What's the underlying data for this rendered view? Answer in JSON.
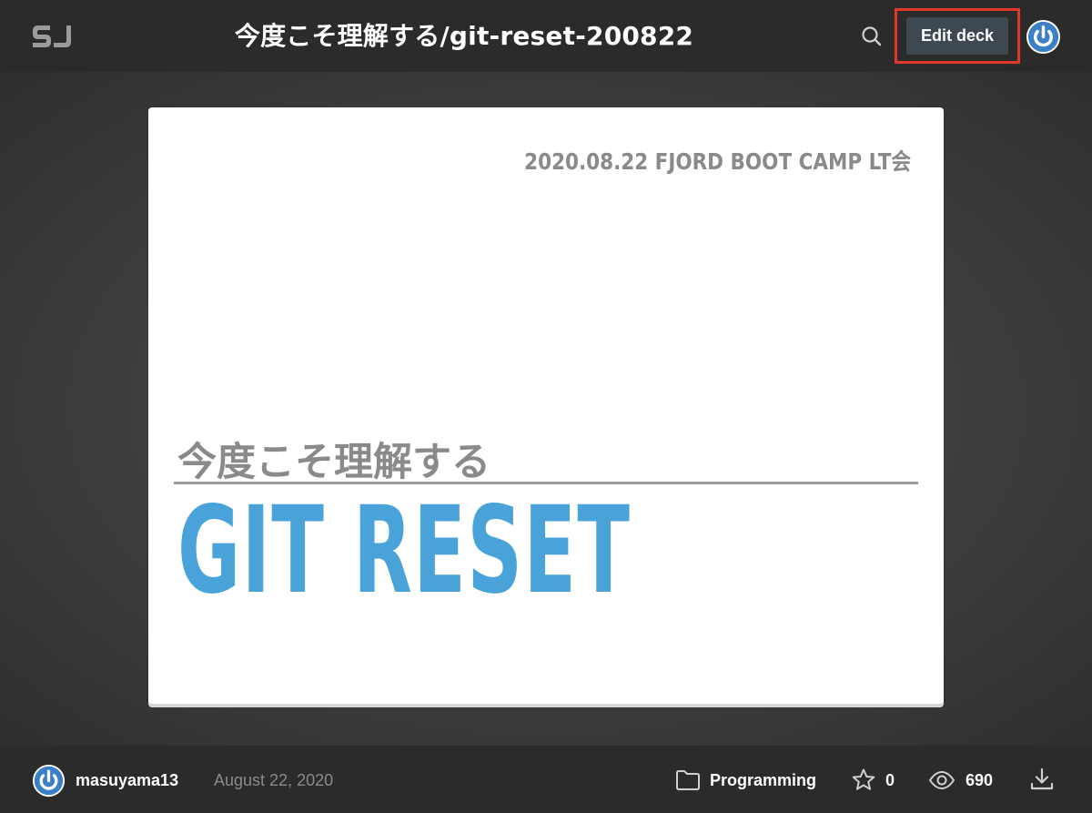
{
  "header": {
    "logo_text": "SJ",
    "title": "今度こそ理解する/git-reset-200822",
    "search_icon": "search-icon",
    "edit_label": "Edit deck",
    "highlight_color": "#e0392b",
    "avatar_icon": "power-icon"
  },
  "slide": {
    "event_line": "2020.08.22 FJORD BOOT CAMP LT会",
    "subtitle": "今度こそ理解する",
    "main_title": "GIT RESET",
    "accent_color": "#4aa3d8"
  },
  "footer": {
    "username": "masuyama13",
    "date": "August 22, 2020",
    "category": "Programming",
    "star_count": "0",
    "view_count": "690",
    "icons": [
      "power-icon",
      "folder-icon",
      "star-icon",
      "eye-icon",
      "download-icon"
    ]
  }
}
